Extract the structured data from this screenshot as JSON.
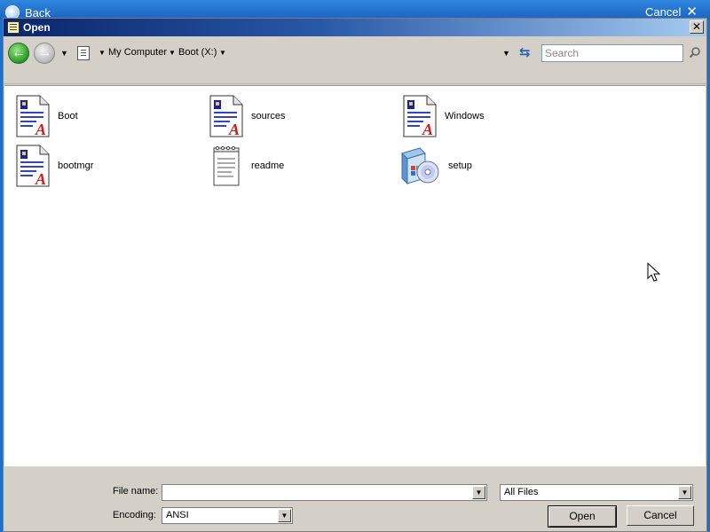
{
  "background": {
    "back_label": "Back",
    "cancel_label": "Cancel"
  },
  "dialog": {
    "title": "Open",
    "close_glyph": "✕"
  },
  "navbar": {
    "breadcrumb": [
      "My Computer",
      "Boot (X:)"
    ],
    "search_placeholder": "Search"
  },
  "files": [
    {
      "name": "Boot",
      "icon": "document-a-icon"
    },
    {
      "name": "sources",
      "icon": "document-a-icon"
    },
    {
      "name": "Windows",
      "icon": "document-a-icon"
    },
    {
      "name": "bootmgr",
      "icon": "document-a-icon"
    },
    {
      "name": "readme",
      "icon": "notepad-icon"
    },
    {
      "name": "setup",
      "icon": "setup-cd-icon"
    }
  ],
  "bottom": {
    "filename_label": "File name:",
    "filename_value": "",
    "filetype_value": "All Files",
    "encoding_label": "Encoding:",
    "encoding_value": "ANSI",
    "open_label": "Open",
    "cancel_label": "Cancel"
  },
  "colors": {
    "title_gradient_start": "#0a246a",
    "title_gradient_end": "#a6caf0",
    "dialog_face": "#d4d0c8",
    "wizard_blue": "#1f6fc9"
  }
}
